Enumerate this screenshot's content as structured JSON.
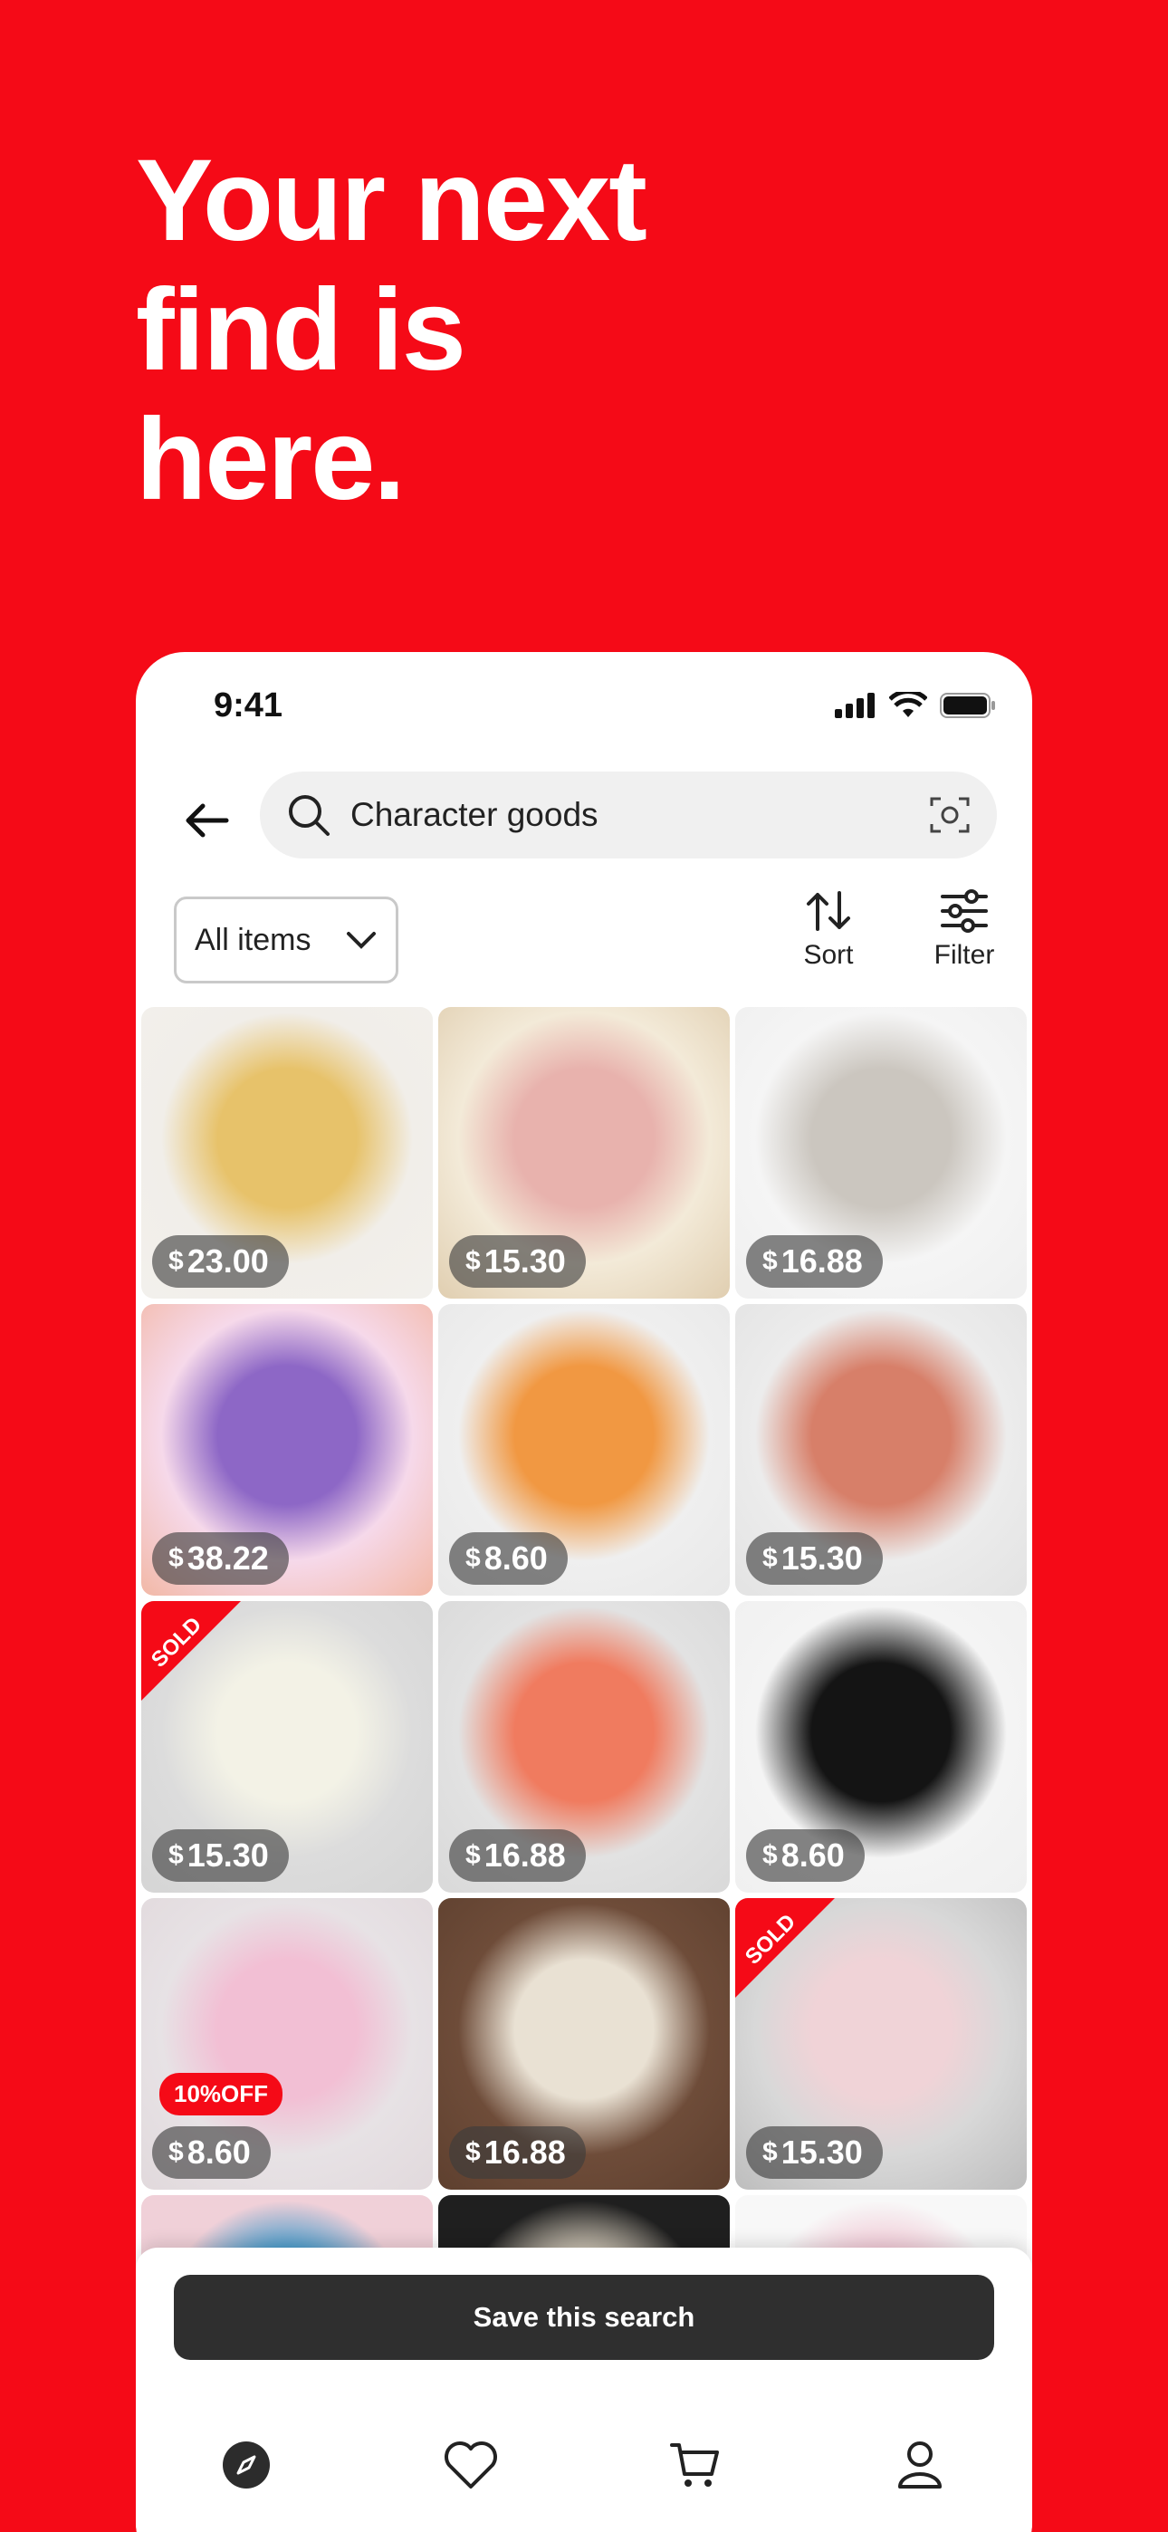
{
  "headline": [
    "Your next",
    "find is",
    "here."
  ],
  "status": {
    "time": "9:41"
  },
  "search": {
    "query": "Character goods"
  },
  "filters": {
    "all_items": "All items",
    "sort": "Sort",
    "filter": "Filter"
  },
  "products": [
    {
      "price": "23.00",
      "sold": false,
      "discount": null,
      "colors": [
        "#f1eee9",
        "#e7c26a",
        "#f2f0ec"
      ]
    },
    {
      "price": "15.30",
      "sold": false,
      "discount": null,
      "colors": [
        "#f3ead8",
        "#e8b2ad",
        "#e0ceb0"
      ]
    },
    {
      "price": "16.88",
      "sold": false,
      "discount": null,
      "colors": [
        "#f5f5f5",
        "#cbc6bf",
        "#efefef"
      ]
    },
    {
      "price": "38.22",
      "sold": false,
      "discount": null,
      "colors": [
        "#f6d9ea",
        "#8d67c6",
        "#f2b8a6"
      ]
    },
    {
      "price": "8.60",
      "sold": false,
      "discount": null,
      "colors": [
        "#efefef",
        "#f19842",
        "#e8e8e8"
      ]
    },
    {
      "price": "15.30",
      "sold": false,
      "discount": null,
      "colors": [
        "#ececec",
        "#d77f69",
        "#e3e3e3"
      ]
    },
    {
      "price": "15.30",
      "sold": true,
      "discount": null,
      "colors": [
        "#dcdcdc",
        "#f3f2e6",
        "#d5d5d5"
      ]
    },
    {
      "price": "16.88",
      "sold": false,
      "discount": null,
      "colors": [
        "#e2e2e2",
        "#f07b5f",
        "#d9d9d9"
      ]
    },
    {
      "price": "8.60",
      "sold": false,
      "discount": null,
      "colors": [
        "#f4f4f4",
        "#141414",
        "#f0f0f0"
      ]
    },
    {
      "price": "8.60",
      "sold": false,
      "discount": "10%OFF",
      "colors": [
        "#e7e2e5",
        "#f2bfd4",
        "#e1d9dc"
      ]
    },
    {
      "price": "16.88",
      "sold": false,
      "discount": null,
      "colors": [
        "#6e4c39",
        "#e9e1d3",
        "#5e402f"
      ]
    },
    {
      "price": "15.30",
      "sold": true,
      "discount": null,
      "colors": [
        "#d8d8d8",
        "#f0d3d7",
        "#bdbdbd"
      ]
    },
    {
      "price": "",
      "sold": false,
      "discount": null,
      "colors": [
        "#f0d0d8",
        "#2f93c8",
        "#f0d0d8"
      ]
    },
    {
      "price": "",
      "sold": false,
      "discount": null,
      "colors": [
        "#1f1f1f",
        "#e4dac8",
        "#1f1f1f"
      ]
    },
    {
      "price": "",
      "sold": false,
      "discount": null,
      "colors": [
        "#f8f8f8",
        "#f0c3d1",
        "#f8f8f8"
      ]
    }
  ],
  "labels": {
    "sold": "SOLD",
    "currency": "$"
  },
  "bottom": {
    "save_search": "Save this search"
  },
  "tabs": [
    "compass-icon",
    "heart-icon",
    "cart-icon",
    "profile-icon"
  ],
  "accent": "#f50a17"
}
